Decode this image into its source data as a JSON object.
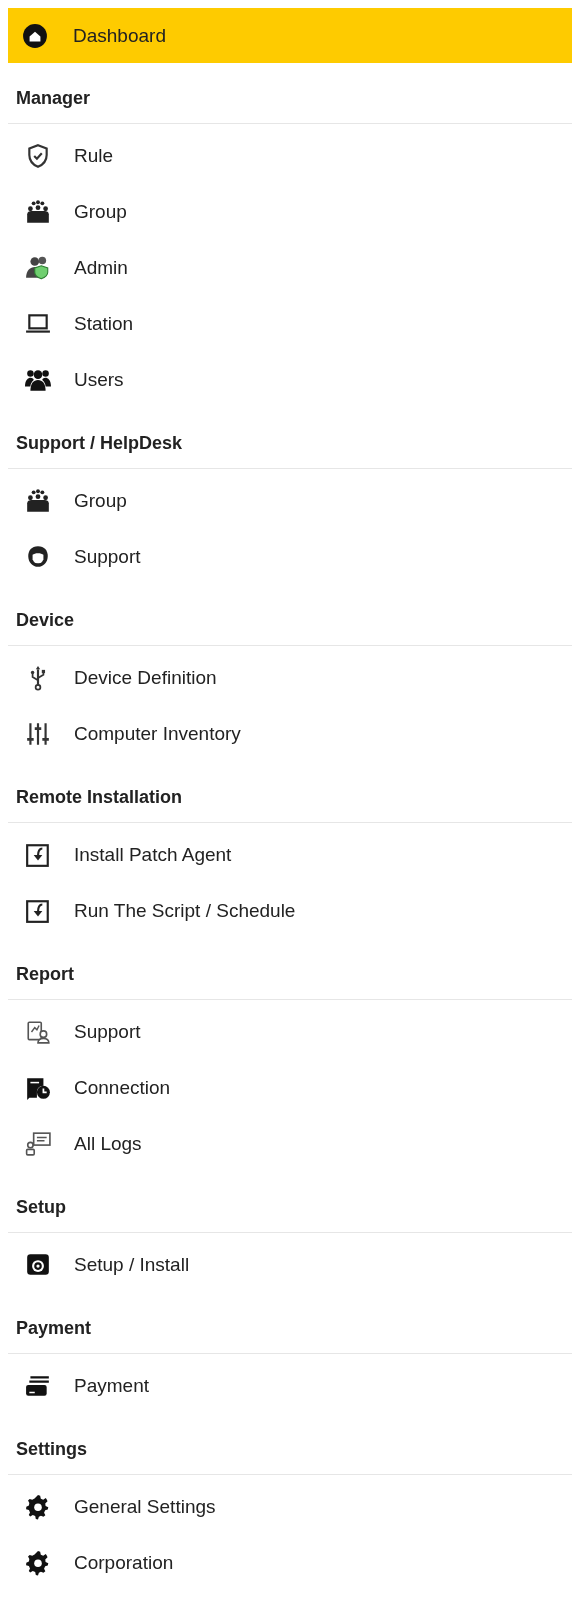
{
  "dashboard": {
    "label": "Dashboard",
    "selected": true
  },
  "sections": [
    {
      "title": "Manager",
      "items": [
        {
          "label": "Rule",
          "selected": false
        },
        {
          "label": "Group",
          "selected": false
        },
        {
          "label": "Admin",
          "selected": false
        },
        {
          "label": "Station",
          "selected": false
        },
        {
          "label": "Users",
          "selected": false
        }
      ]
    },
    {
      "title": "Support / HelpDesk",
      "items": [
        {
          "label": "Group",
          "selected": false
        },
        {
          "label": "Support",
          "selected": false
        }
      ]
    },
    {
      "title": "Device",
      "items": [
        {
          "label": "Device Definition",
          "selected": false
        },
        {
          "label": "Computer Inventory",
          "selected": false
        }
      ]
    },
    {
      "title": "Remote Installation",
      "items": [
        {
          "label": "Install Patch Agent",
          "selected": false
        },
        {
          "label": "Run The Script / Schedule",
          "selected": false
        }
      ]
    },
    {
      "title": "Report",
      "items": [
        {
          "label": "Support",
          "selected": false
        },
        {
          "label": "Connection",
          "selected": false
        },
        {
          "label": "All Logs",
          "selected": false
        }
      ]
    },
    {
      "title": "Setup",
      "items": [
        {
          "label": "Setup / Install",
          "selected": false
        }
      ]
    },
    {
      "title": "Payment",
      "items": [
        {
          "label": "Payment",
          "selected": false
        }
      ]
    },
    {
      "title": "Settings",
      "items": [
        {
          "label": "General Settings",
          "selected": false
        },
        {
          "label": "Corporation",
          "selected": false
        }
      ]
    }
  ]
}
